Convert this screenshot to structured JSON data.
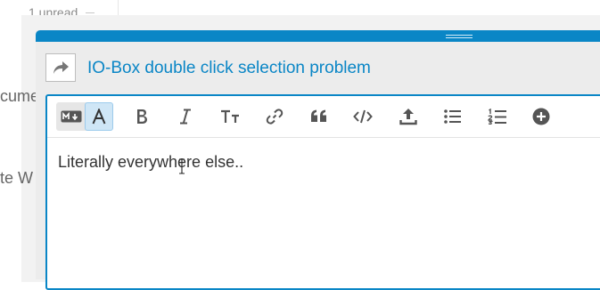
{
  "background": {
    "unread_label": "1 unread",
    "partial_text_1": "cume",
    "partial_text_2": "te W"
  },
  "composer": {
    "topic_title": "IO-Box double click selection problem",
    "editor_text": "Literally everywhere else..",
    "toolbar_icons": [
      "markdown-mode-icon",
      "rich-text-mode-icon",
      "bold-icon",
      "italic-icon",
      "heading-icon",
      "link-icon",
      "blockquote-icon",
      "code-icon",
      "upload-icon",
      "bullet-list-icon",
      "numbered-list-icon",
      "add-icon"
    ]
  },
  "colors": {
    "accent": "#0a86c6",
    "icon": "#555555",
    "text": "#333333"
  }
}
